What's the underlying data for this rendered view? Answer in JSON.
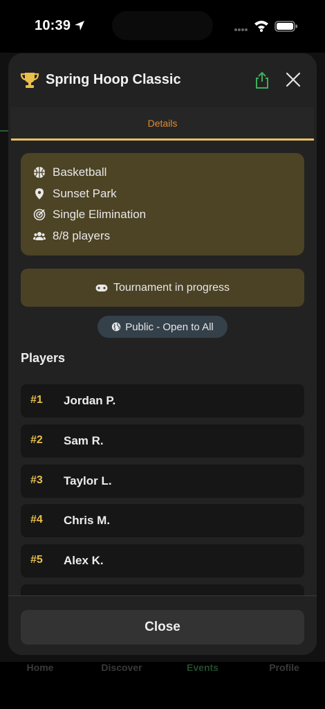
{
  "status": {
    "time": "10:39"
  },
  "modal": {
    "title": "Spring Hoop Classic",
    "tabs": [
      {
        "label": "Details"
      }
    ],
    "info": {
      "sport": "Basketball",
      "location": "Sunset Park",
      "format": "Single Elimination",
      "players": "8/8 players"
    },
    "progress_text": "Tournament in progress",
    "visibility": "Public - Open to All",
    "players_heading": "Players",
    "players": [
      {
        "rank": "#1",
        "name": "Jordan P."
      },
      {
        "rank": "#2",
        "name": "Sam R."
      },
      {
        "rank": "#3",
        "name": "Taylor L."
      },
      {
        "rank": "#4",
        "name": "Chris M."
      },
      {
        "rank": "#5",
        "name": "Alex K."
      }
    ],
    "close_label": "Close"
  },
  "background_nav": {
    "items": [
      {
        "label": "Home"
      },
      {
        "label": "Discover"
      },
      {
        "label": "Events"
      },
      {
        "label": "Profile"
      }
    ],
    "active": "Events"
  },
  "colors": {
    "accent_orange": "#e58a2e",
    "accent_gold": "#e9bf4a",
    "share_green": "#3fae5a",
    "card_brown": "#4d4325"
  },
  "icons": {
    "trophy": "trophy-icon",
    "share": "share-icon",
    "close": "close-icon",
    "sport": "basketball-icon",
    "location": "pin-icon",
    "format": "target-icon",
    "players": "users-icon",
    "progress": "gamepad-icon",
    "visibility": "globe-icon"
  }
}
